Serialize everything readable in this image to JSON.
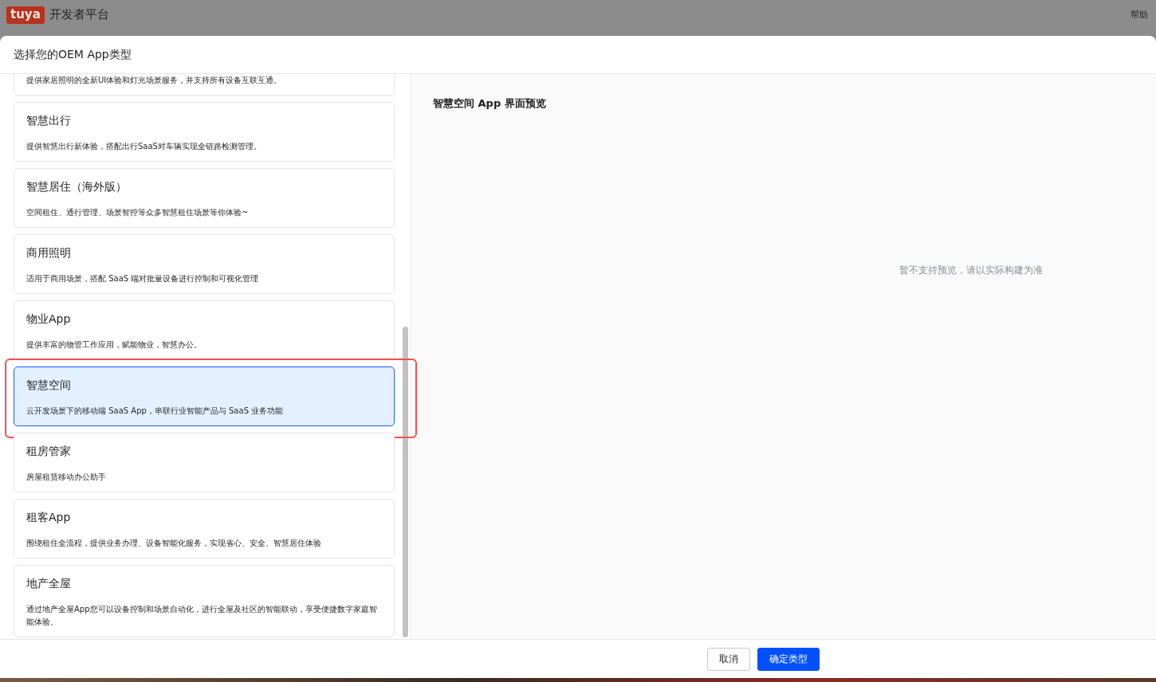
{
  "topbar": {
    "logo": "tuya",
    "title": "开发者平台",
    "help": "帮助"
  },
  "dialog": {
    "title": "选择您的OEM App类型"
  },
  "app_types": [
    {
      "description": "提供家居照明的全新UI体验和灯光场景服务，并支持所有设备互联互通。",
      "selected": false,
      "highlighted": false
    },
    {
      "title": "智慧出行",
      "description": "提供智慧出行新体验，搭配出行SaaS对车辆实现全链路检测管理。",
      "selected": false,
      "highlighted": false
    },
    {
      "title": "智慧居住（海外版）",
      "description": "空间租住、通行管理、场景智控等众多智慧租住场景等你体验~",
      "selected": false,
      "highlighted": false
    },
    {
      "title": "商用照明",
      "description": "适用于商用场景，搭配 SaaS 端对批量设备进行控制和可视化管理",
      "selected": false,
      "highlighted": false
    },
    {
      "title": "物业App",
      "description": "提供丰富的物管工作应用，赋能物业，智慧办公。",
      "selected": false,
      "highlighted": false
    },
    {
      "title": "智慧空间",
      "description": "云开发场景下的移动端 SaaS App，串联行业智能产品与 SaaS 业务功能",
      "selected": true,
      "highlighted": true
    },
    {
      "title": "租房管家",
      "description": "房屋租赁移动办公助手",
      "selected": false,
      "highlighted": false
    },
    {
      "title": "租客App",
      "description": "围绕租住全流程，提供业务办理、设备智能化服务，实现省心、安全、智慧居住体验",
      "selected": false,
      "highlighted": false
    },
    {
      "title": "地产全屋",
      "description": "通过地产全屋App您可以设备控制和场景自动化，进行全屋及社区的智能联动，享受便捷数字家庭智能体验。",
      "selected": false,
      "highlighted": false
    }
  ],
  "preview": {
    "title": "智慧空间 App 界面预览",
    "message": "暂不支持预览，请以实际构建为准"
  },
  "buttons": [
    {
      "label": "取消",
      "kind": "secondary"
    },
    {
      "label": "确定类型",
      "kind": "primary"
    }
  ]
}
